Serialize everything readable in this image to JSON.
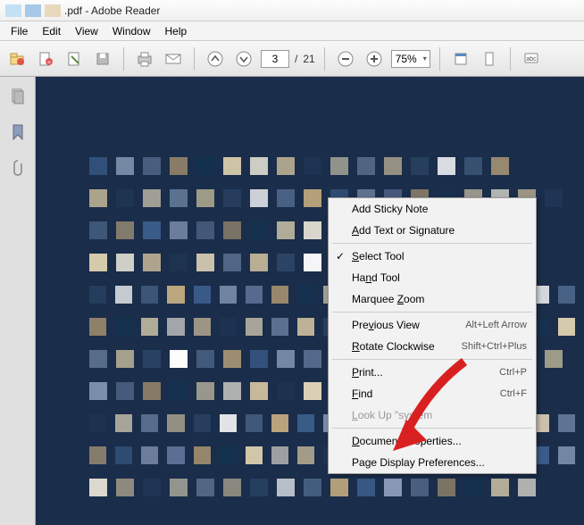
{
  "titlebar": {
    "filename": ".pdf",
    "appname": "Adobe Reader"
  },
  "menubar": {
    "items": [
      "File",
      "Edit",
      "View",
      "Window",
      "Help"
    ]
  },
  "toolbar": {
    "current_page": "3",
    "page_sep": "/",
    "total_pages": "21",
    "zoom_value": "75%"
  },
  "contextmenu": {
    "add_sticky": "Add Sticky Note",
    "add_text": "Add Text or Signature",
    "select_tool": "Select Tool",
    "hand_tool": "Hand Tool",
    "marquee_zoom": "Marquee Zoom",
    "previous_view": "Previous View",
    "previous_view_sc": "Alt+Left Arrow",
    "rotate_cw": "Rotate Clockwise",
    "rotate_cw_sc": "Shift+Ctrl+Plus",
    "print": "Print...",
    "print_sc": "Ctrl+P",
    "find": "Find",
    "find_sc": "Ctrl+F",
    "lookup": "Look Up \"system",
    "doc_props": "Document Properties...",
    "page_display": "Page Display Preferences..."
  },
  "mosaic_colors": [
    "#3a5d8a",
    "#c4b89a",
    "#e6e2d6",
    "#8a9dba",
    "#2d4668",
    "#d6c4a0",
    "#5d7296",
    "#ffffff",
    "#1f3654",
    "#a38f6e",
    "#4b6588",
    "#e2d6ba",
    "#133250",
    "#c0a87e",
    "#6a80a0",
    "#dccfae"
  ]
}
